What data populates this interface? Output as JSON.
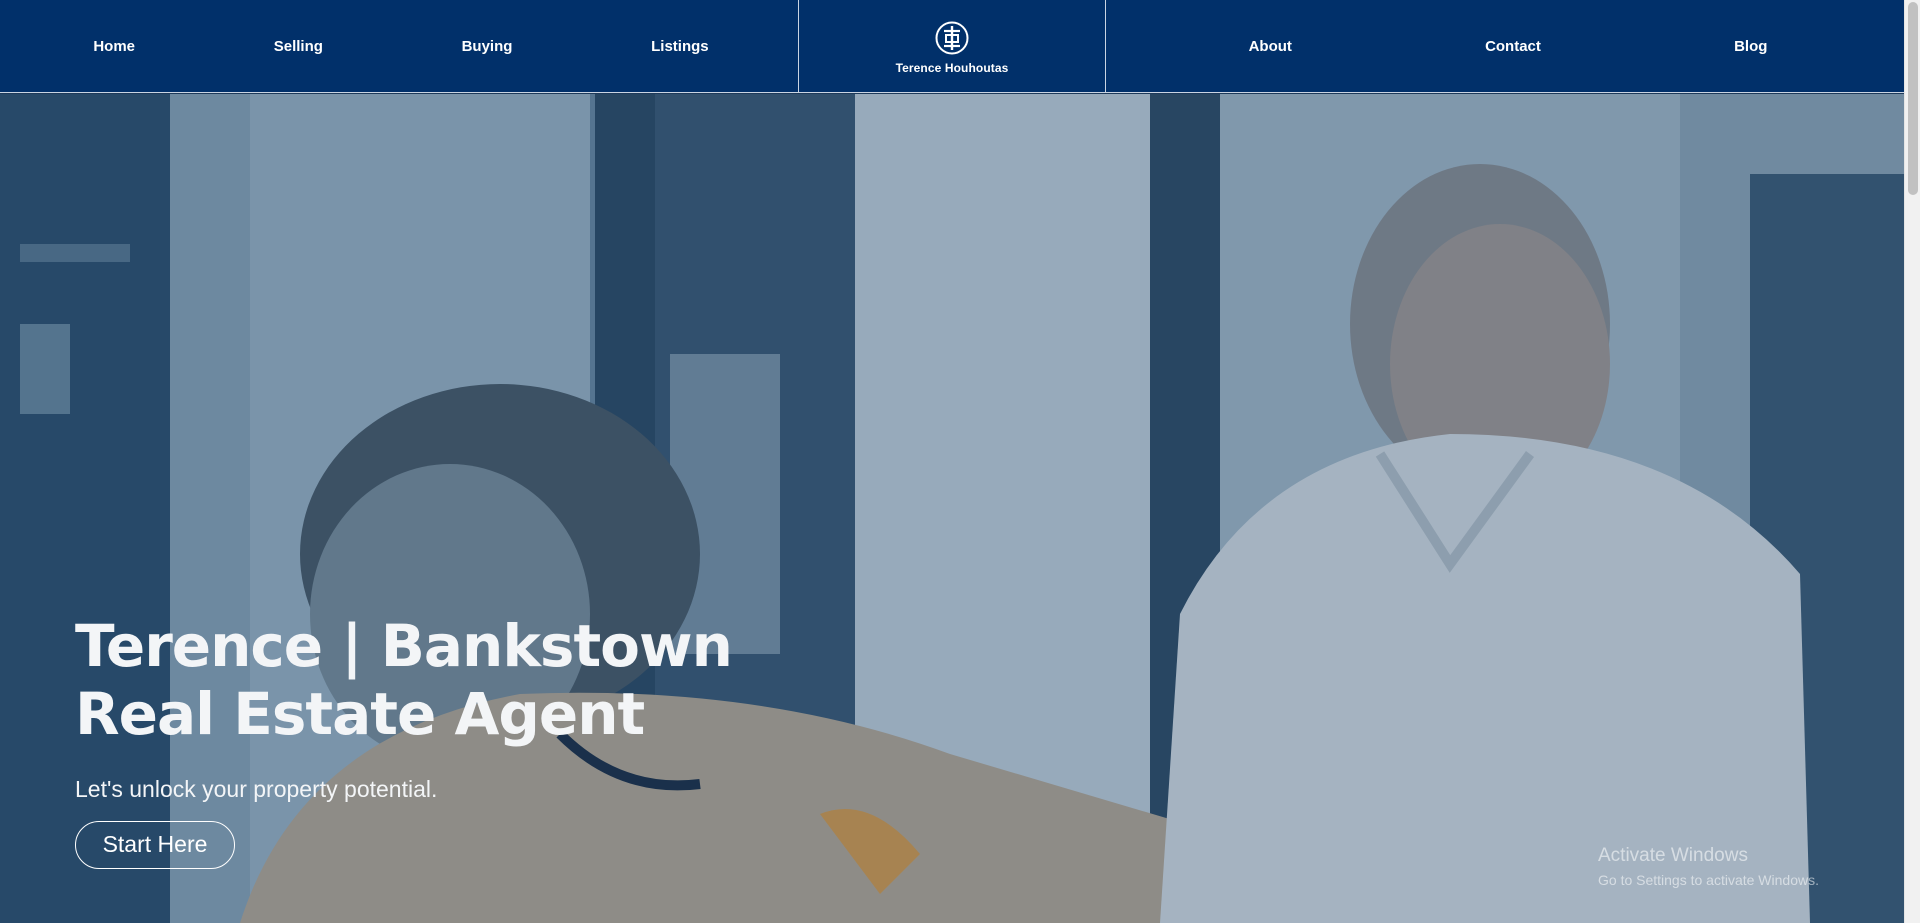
{
  "navbar": {
    "left_links": [
      {
        "label": "Home"
      },
      {
        "label": "Selling"
      },
      {
        "label": "Buying"
      },
      {
        "label": "Listings"
      }
    ],
    "brand": {
      "name": "Terence Houhoutas",
      "logo_icon": "monogram-logo-icon"
    },
    "right_links": [
      {
        "label": "About"
      },
      {
        "label": "Contact"
      },
      {
        "label": "Blog"
      }
    ]
  },
  "hero": {
    "title_line1": "Terence | Bankstown",
    "title_line2": "Real Estate Agent",
    "subtitle": "Let's unlock your property potential.",
    "cta_label": "Start Here"
  },
  "watermark": {
    "title": "Activate Windows",
    "subtitle": "Go to Settings to activate Windows."
  },
  "colors": {
    "nav_background": "#01306a",
    "text_light": "#ffffff",
    "overlay_tint": "#14375f"
  }
}
